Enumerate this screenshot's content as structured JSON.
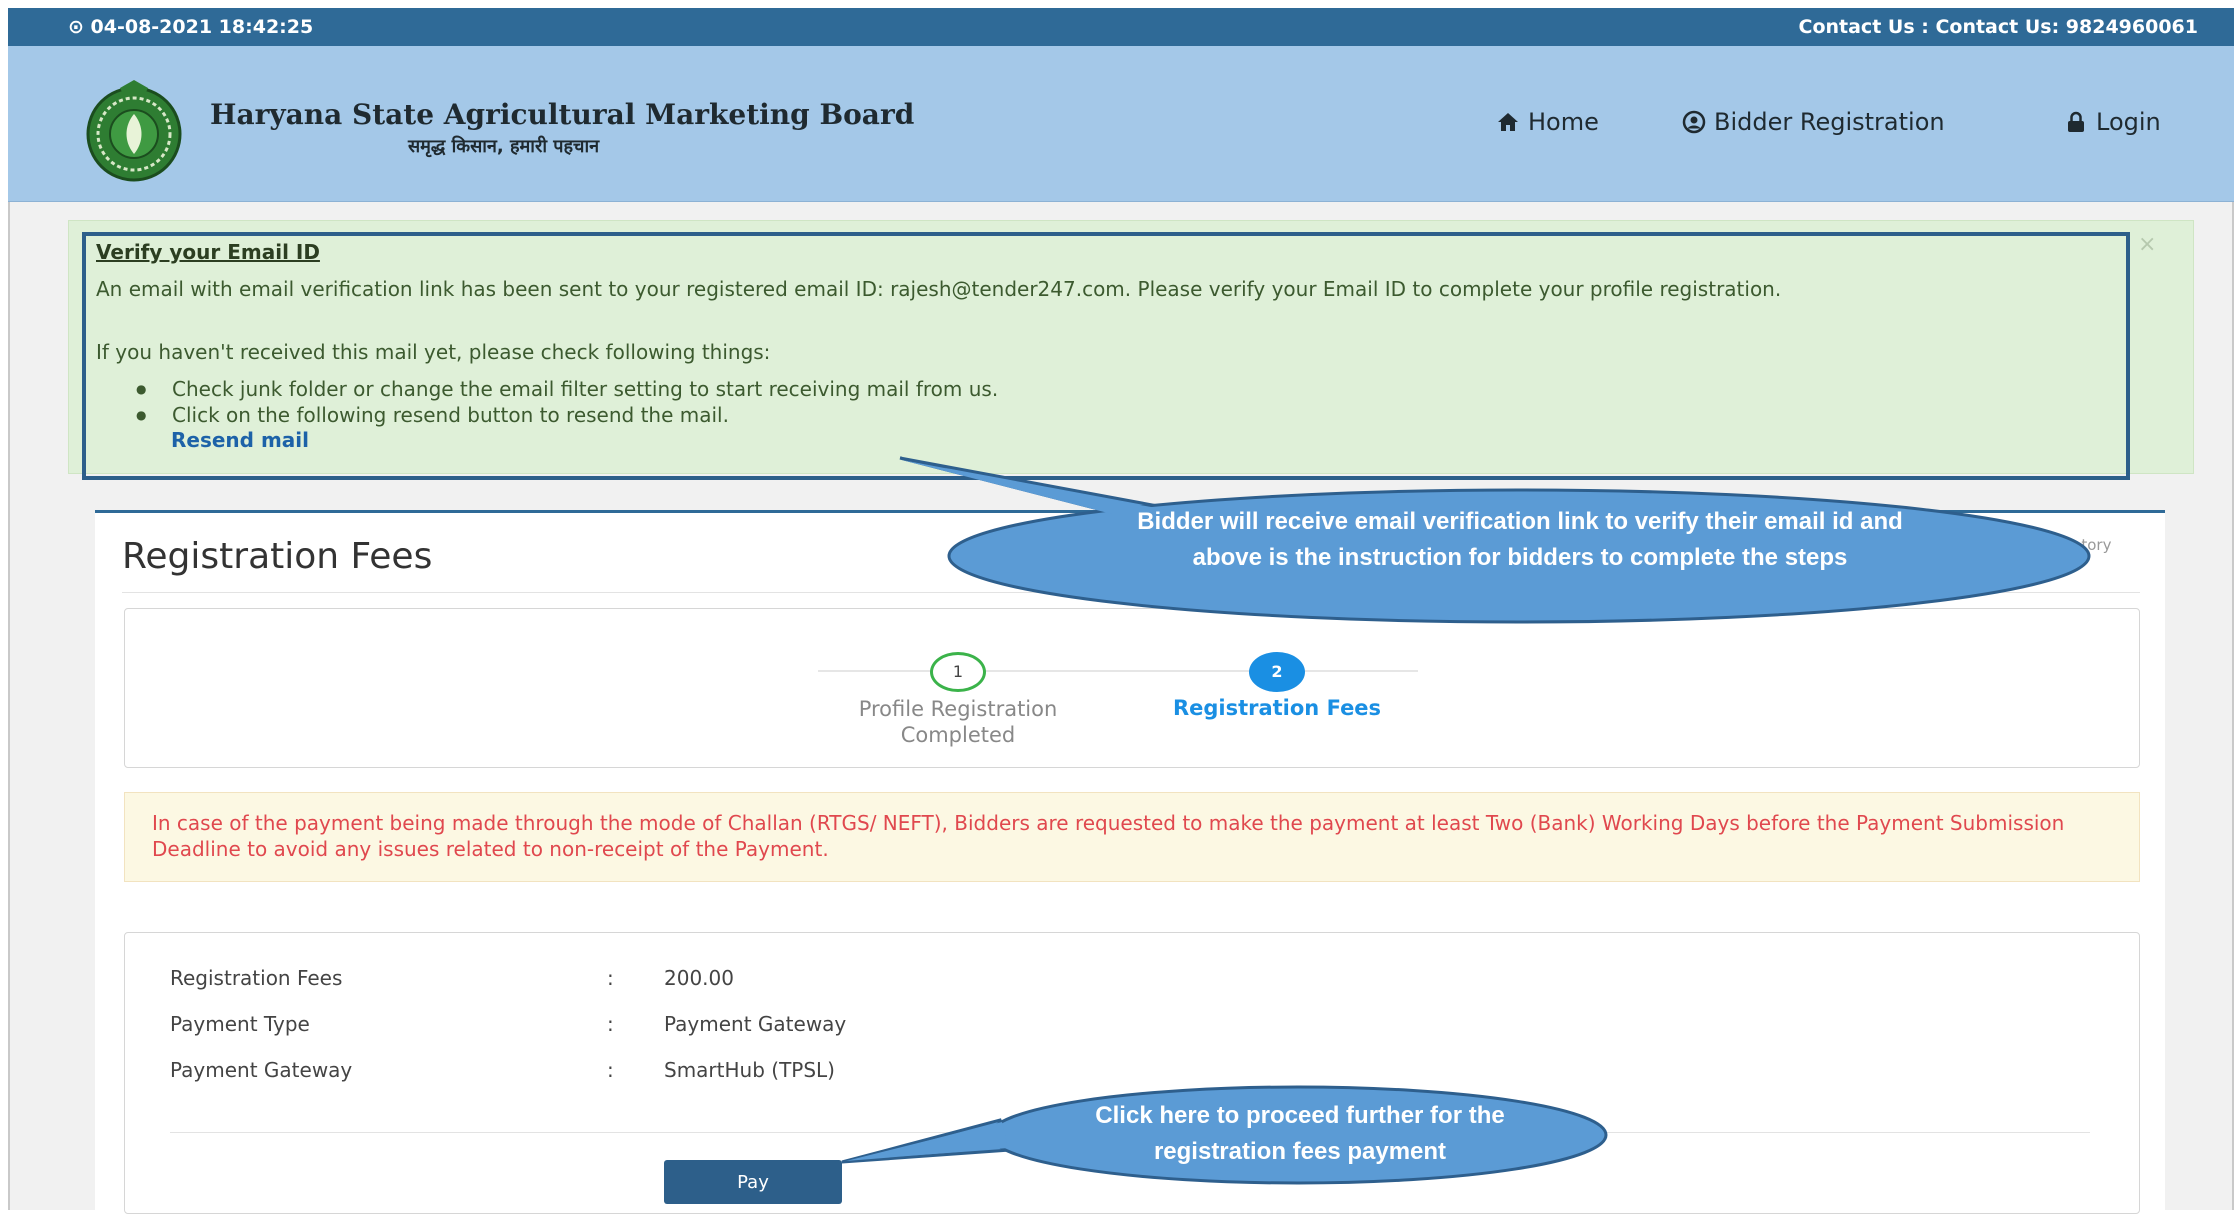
{
  "topbar": {
    "datetime": "⊙ 04-08-2021 18:42:25",
    "contact": "Contact Us : Contact Us: 9824960061"
  },
  "brand": {
    "title": "Haryana State Agricultural Marketing Board",
    "subtitle": "समृद्ध किसान, हमारी पहचान"
  },
  "nav": {
    "home": "Home",
    "bidder_registration": "Bidder Registration",
    "login": "Login"
  },
  "alert": {
    "title": "Verify your Email ID",
    "message": "An email with email verification link has been sent to your registered email ID: rajesh@tender247.com. Please verify your Email ID to complete your profile registration.",
    "intro": "If you haven't received this mail yet, please check following things:",
    "items": [
      "Check junk folder or change the email filter setting to start receiving mail from us.",
      "Click on the following resend button to resend the mail."
    ],
    "resend_label": "Resend mail",
    "close": "×"
  },
  "panel": {
    "title": "Registration Fees",
    "mandatory_note": "latory"
  },
  "steps": [
    {
      "number": "1",
      "label": "Profile Registration Completed"
    },
    {
      "number": "2",
      "label": "Registration Fees"
    }
  ],
  "warning": "In case of the payment being made through the mode of Challan (RTGS/ NEFT), Bidders are requested to make the payment at least Two (Bank) Working Days before the Payment Submission Deadline to avoid any issues related to non-receipt of the Payment.",
  "details": [
    {
      "label": "Registration Fees",
      "value": "200.00"
    },
    {
      "label": "Payment Type",
      "value": "Payment Gateway"
    },
    {
      "label": "Payment Gateway",
      "value": "SmartHub (TPSL)"
    }
  ],
  "pay_label": "Pay",
  "callouts": {
    "email": "Bidder will receive email verification link to verify their email id and above is the instruction for bidders to complete the steps",
    "pay": "Click here to proceed further for the registration fees payment"
  },
  "colors": {
    "topbar": "#2f6a97",
    "header": "#a4c8e8",
    "accent": "#1a8fe3",
    "callout": "#5b9bd5"
  }
}
